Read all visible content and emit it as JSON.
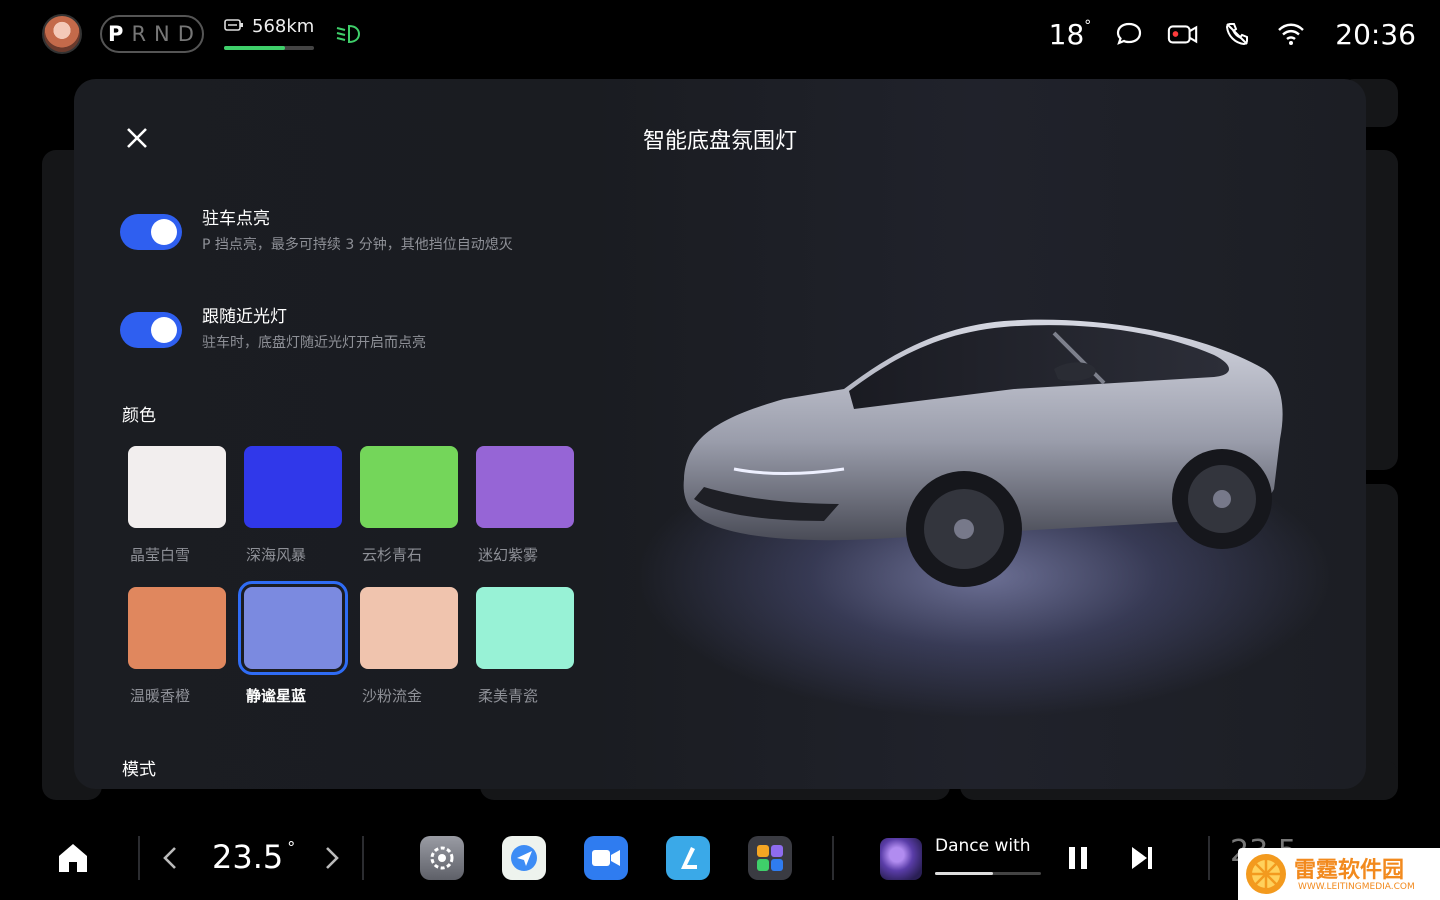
{
  "status_bar": {
    "gears": [
      "P",
      "R",
      "N",
      "D"
    ],
    "active_gear": "P",
    "range": "568km",
    "range_level": 0.68,
    "outside_temp": "18",
    "outside_temp_unit": "°",
    "time": "20:36",
    "icons": [
      "user-avatar",
      "ev-battery-icon",
      "low-beam-icon",
      "message-icon",
      "camera-icon",
      "phone-icon",
      "wifi-icon"
    ]
  },
  "modal": {
    "title": "智能底盘氛围灯",
    "settings": [
      {
        "title": "驻车点亮",
        "desc": "P 挡点亮，最多可持续 3 分钟，其他挡位自动熄灭",
        "enabled": true
      },
      {
        "title": "跟随近光灯",
        "desc": "驻车时，底盘灯随近光灯开启而点亮",
        "enabled": true
      }
    ],
    "color_label": "颜色",
    "mode_label": "模式",
    "colors": [
      {
        "name": "晶莹白雪",
        "hex": "#f2eeee"
      },
      {
        "name": "深海风暴",
        "hex": "#3038ea"
      },
      {
        "name": "云杉青石",
        "hex": "#74d65a"
      },
      {
        "name": "迷幻紫雾",
        "hex": "#9665d6"
      },
      {
        "name": "温暖香橙",
        "hex": "#e0875e"
      },
      {
        "name": "静谧星蓝",
        "hex": "#7b8ae0"
      },
      {
        "name": "沙粉流金",
        "hex": "#f0c4ae"
      },
      {
        "name": "柔美青瓷",
        "hex": "#98f2d6"
      }
    ],
    "selected_color": "静谧星蓝",
    "accent": "#2f5ff0"
  },
  "dock": {
    "climate_temp": "23.5",
    "climate_unit": "°",
    "apps": [
      "settings-app-icon",
      "navigation-app-icon",
      "video-call-app-icon",
      "seat-app-icon",
      "app-grid-icon"
    ],
    "music_title": "Dance with",
    "music_progress": 0.55,
    "right_partial_temp": "23.5"
  },
  "watermark": {
    "text": "雷霆软件园",
    "sub": "WWW.LEITINGMEDIA.COM"
  }
}
